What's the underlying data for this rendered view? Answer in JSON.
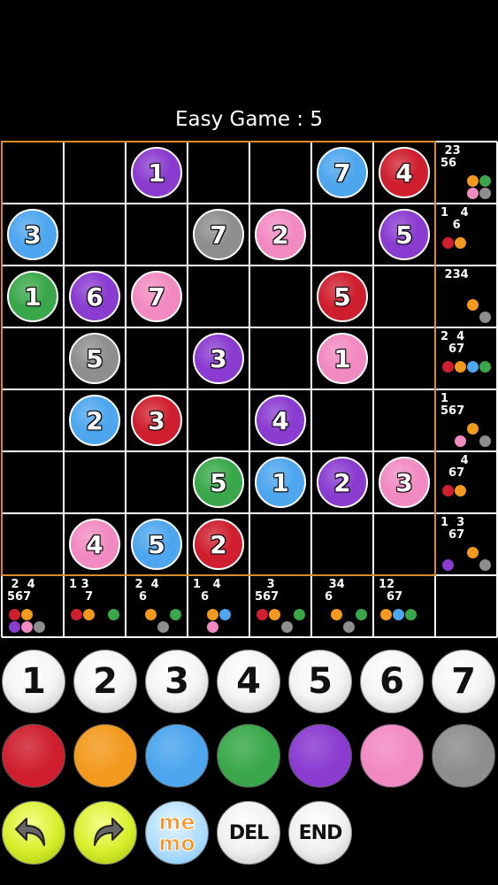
{
  "title": "Easy Game : 5",
  "colors": {
    "1": "#cf1f2e",
    "2": "#f39a1e",
    "3": "#4da6ee",
    "4": "#3aa84a",
    "5": "#8a3bd0",
    "6": "#f28ac2",
    "7": "#8e8e8e"
  },
  "grid": [
    [
      null,
      null,
      {
        "n": "1",
        "c": 5
      },
      null,
      null,
      {
        "n": "7",
        "c": 3
      },
      {
        "n": "4",
        "c": 1
      }
    ],
    [
      {
        "n": "3",
        "c": 3
      },
      null,
      null,
      {
        "n": "7",
        "c": 7
      },
      {
        "n": "2",
        "c": 6
      },
      null,
      {
        "n": "5",
        "c": 5
      }
    ],
    [
      {
        "n": "1",
        "c": 4
      },
      {
        "n": "6",
        "c": 5
      },
      {
        "n": "7",
        "c": 6
      },
      null,
      null,
      {
        "n": "5",
        "c": 1
      },
      null
    ],
    [
      null,
      {
        "n": "5",
        "c": 7
      },
      null,
      {
        "n": "3",
        "c": 5
      },
      null,
      {
        "n": "1",
        "c": 6
      },
      null
    ],
    [
      null,
      {
        "n": "2",
        "c": 3
      },
      {
        "n": "3",
        "c": 1
      },
      null,
      {
        "n": "4",
        "c": 5
      },
      null,
      null
    ],
    [
      null,
      null,
      null,
      {
        "n": "5",
        "c": 4
      },
      {
        "n": "1",
        "c": 3
      },
      {
        "n": "2",
        "c": 5
      },
      {
        "n": "3",
        "c": 6
      }
    ],
    [
      null,
      {
        "n": "4",
        "c": 6
      },
      {
        "n": "5",
        "c": 3
      },
      {
        "n": "2",
        "c": 1
      },
      null,
      null,
      null
    ]
  ],
  "row_hints": [
    {
      "digits": " 23\n56 ",
      "dots": [
        [
          null,
          null,
          2,
          4
        ],
        [
          null,
          null,
          6,
          7
        ]
      ]
    },
    {
      "digits": "1   4\n   6 ",
      "dots": [
        [
          1,
          2,
          null,
          null
        ]
      ]
    },
    {
      "digits": " 234\n     ",
      "dots": [
        [
          null,
          null,
          2,
          null
        ],
        [
          null,
          null,
          null,
          7
        ]
      ]
    },
    {
      "digits": "2  4\n  67",
      "dots": [
        [
          1,
          2,
          3,
          4
        ]
      ]
    },
    {
      "digits": "1\n567",
      "dots": [
        [
          null,
          null,
          2,
          null
        ],
        [
          null,
          6,
          null,
          7
        ]
      ]
    },
    {
      "digits": "     4\n  67",
      "dots": [
        [
          1,
          2,
          null,
          null
        ]
      ]
    },
    {
      "digits": "1  3\n  67",
      "dots": [
        [
          null,
          null,
          2,
          null
        ],
        [
          5,
          null,
          null,
          7
        ]
      ]
    }
  ],
  "col_hints": [
    {
      "digits": " 2  4\n567",
      "dots": [
        [
          1,
          2,
          null,
          null
        ],
        [
          5,
          6,
          7,
          null
        ]
      ]
    },
    {
      "digits": "1 3\n    7",
      "dots": [
        [
          1,
          2,
          null,
          4
        ]
      ]
    },
    {
      "digits": " 2  4\n  6",
      "dots": [
        [
          null,
          2,
          null,
          4
        ],
        [
          null,
          null,
          7,
          null
        ]
      ]
    },
    {
      "digits": "1   4\n  6",
      "dots": [
        [
          null,
          2,
          3,
          null
        ],
        [
          null,
          6,
          null,
          null
        ]
      ]
    },
    {
      "digits": "   3\n567",
      "dots": [
        [
          1,
          2,
          null,
          4
        ],
        [
          null,
          null,
          7,
          null
        ]
      ]
    },
    {
      "digits": "   34\n  6",
      "dots": [
        [
          null,
          2,
          null,
          4
        ],
        [
          null,
          null,
          7,
          null
        ]
      ]
    },
    {
      "digits": "12\n  67",
      "dots": [
        [
          2,
          3,
          4,
          null
        ]
      ]
    }
  ],
  "number_buttons": [
    "1",
    "2",
    "3",
    "4",
    "5",
    "6",
    "7"
  ],
  "color_buttons": [
    1,
    2,
    3,
    4,
    5,
    6,
    7
  ],
  "controls": {
    "memo_top": "me",
    "memo_bottom": "mo",
    "del": "DEL",
    "end": "END"
  }
}
